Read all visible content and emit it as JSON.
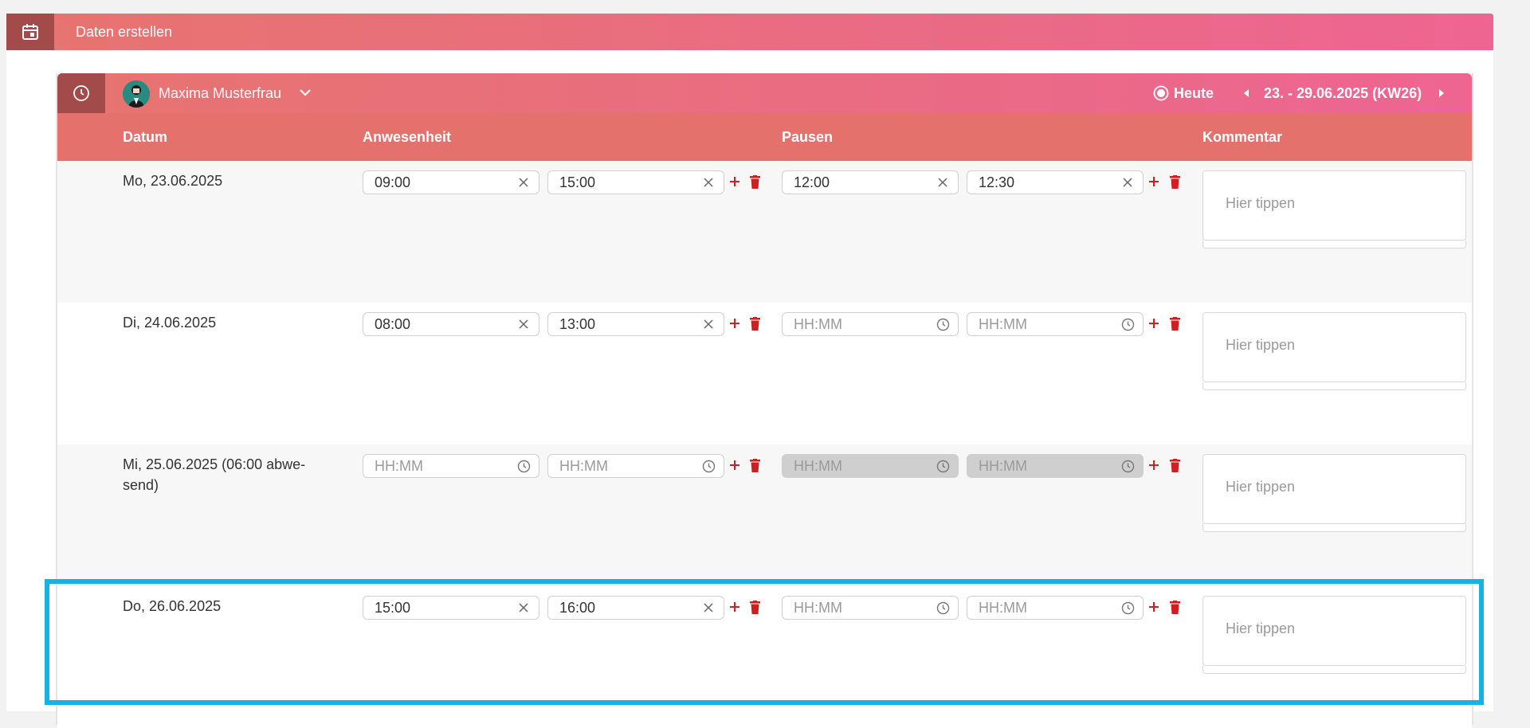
{
  "page": {
    "title": "Daten erstellen"
  },
  "user": {
    "name": "Maxima Musterfrau"
  },
  "week": {
    "today_label": "Heute",
    "range_label": "23. - 29.06.2025 (KW26)"
  },
  "columns": {
    "date": "Datum",
    "presence": "Anwesenheit",
    "breaks": "Pausen",
    "comment": "Kommentar"
  },
  "placeholders": {
    "time": "HH:MM",
    "comment": "Hier tippen"
  },
  "rows": [
    {
      "date": "Mo, 23.06.2025",
      "presence_from": "09:00",
      "presence_to": "15:00",
      "break_from": "12:00",
      "break_to": "12:30",
      "comment": ""
    },
    {
      "date": "Di, 24.06.2025",
      "presence_from": "08:00",
      "presence_to": "13:00",
      "break_from": "",
      "break_to": "",
      "comment": ""
    },
    {
      "date": "Mi, 25.06.2025 (06:00 abwe-send)",
      "presence_from": "",
      "presence_to": "",
      "break_from": "",
      "break_to": "",
      "comment": ""
    },
    {
      "date": "Do, 26.06.2025",
      "presence_from": "15:00",
      "presence_to": "16:00",
      "break_from": "",
      "break_to": "",
      "comment": ""
    }
  ],
  "colors": {
    "header_gradient_start": "#e7746f",
    "header_gradient_end": "#ee6592",
    "accent_dark": "#a34a4a",
    "delete_red": "#d11f1f",
    "highlight": "#1ab0e6"
  },
  "icons": {
    "calendar": "calendar-icon",
    "clock": "clock-icon",
    "clear": "close-icon",
    "time": "clock-icon",
    "add": "plus-icon",
    "delete": "trash-icon"
  }
}
